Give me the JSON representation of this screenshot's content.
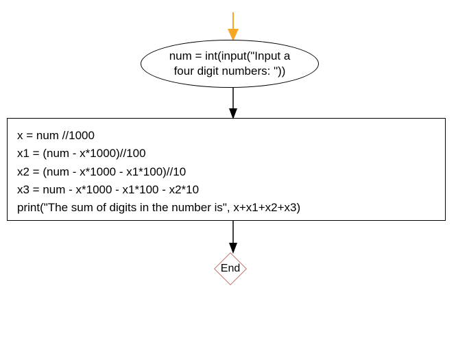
{
  "flowchart": {
    "input_node": "num = int(input(\"Input a four digit numbers: \"))",
    "process_lines": {
      "l1": "x  = num //1000",
      "l2": "x1 = (num - x*1000)//100",
      "l3": "x2 = (num - x*1000 - x1*100)//10",
      "l4": "x3 = num - x*1000 - x1*100 - x2*10",
      "l5": "print(\"The sum of digits in the number is\", x+x1+x2+x3)"
    },
    "end_label": "End"
  }
}
